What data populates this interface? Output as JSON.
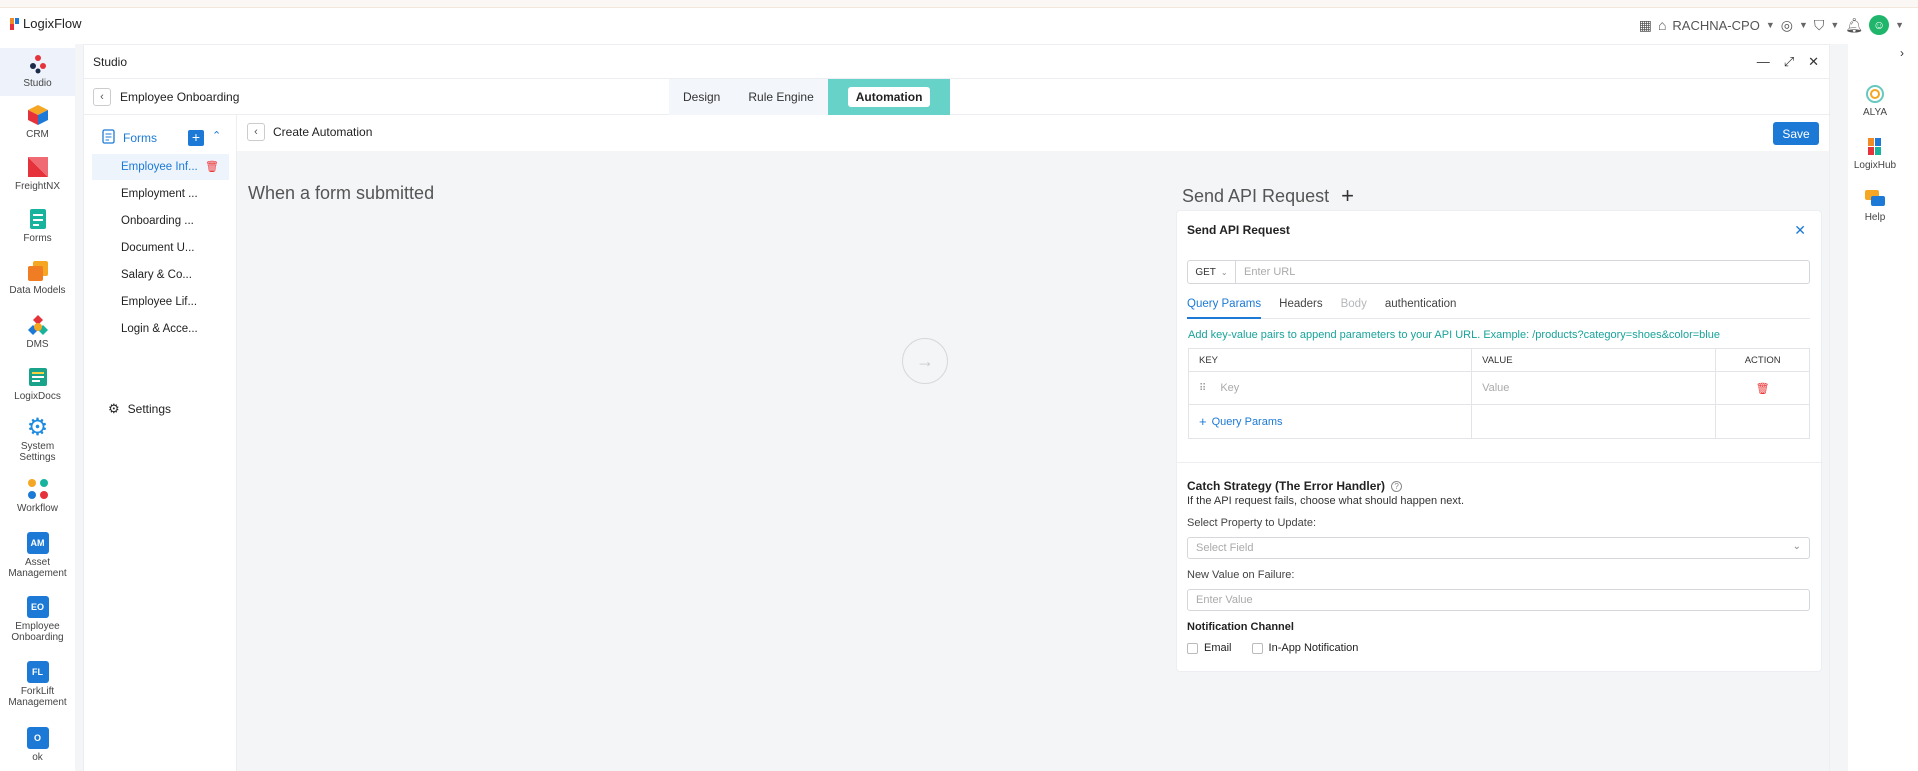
{
  "app": {
    "name": "LogixFlow",
    "user": "RACHNA-CPO"
  },
  "rail": {
    "items": [
      {
        "label": "Studio"
      },
      {
        "label": "CRM"
      },
      {
        "label": "FreightNX"
      },
      {
        "label": "Forms"
      },
      {
        "label": "Data Models"
      },
      {
        "label": "DMS"
      },
      {
        "label": "LogixDocs"
      },
      {
        "label_line1": "System",
        "label_line2": "Settings"
      },
      {
        "label": "Workflow"
      },
      {
        "badge": "AM",
        "label_line1": "Asset",
        "label_line2": "Management"
      },
      {
        "badge": "EO",
        "label_line1": "Employee",
        "label_line2": "Onboarding"
      },
      {
        "badge": "FL",
        "label_line1": "ForkLift",
        "label_line2": "Management"
      },
      {
        "badge": "O",
        "label": "ok"
      }
    ]
  },
  "right_rail": {
    "items": [
      {
        "label": "ALYA"
      },
      {
        "label": "LogixHub"
      },
      {
        "label": "Help"
      }
    ]
  },
  "studio": {
    "title": "Studio",
    "breadcrumb": "Employee Onboarding",
    "tabs": [
      {
        "label": "Design"
      },
      {
        "label": "Rule Engine"
      },
      {
        "label": "Automation"
      }
    ]
  },
  "forms": {
    "header": "Forms",
    "items": [
      {
        "label": "Employee Inf..."
      },
      {
        "label": "Employment ..."
      },
      {
        "label": "Onboarding ..."
      },
      {
        "label": "Document U..."
      },
      {
        "label": "Salary & Co..."
      },
      {
        "label": "Employee Lif..."
      },
      {
        "label": "Login & Acce..."
      }
    ],
    "settings_label": "Settings"
  },
  "automation": {
    "header": "Create Automation",
    "save_label": "Save",
    "trigger_title": "When a form submitted",
    "action_title": "Send API Request"
  },
  "api_card": {
    "title": "Send API Request",
    "method": "GET",
    "url_placeholder": "Enter URL",
    "tabs": [
      {
        "label": "Query Params"
      },
      {
        "label": "Headers"
      },
      {
        "label": "Body"
      },
      {
        "label": "authentication"
      }
    ],
    "hint": "Add key-value pairs to append parameters to your API URL. Example: /products?category=shoes&color=blue",
    "table": {
      "columns": [
        "KEY",
        "VALUE",
        "ACTION"
      ],
      "key_placeholder": "Key",
      "value_placeholder": "Value",
      "add_label": "Query Params"
    },
    "catch": {
      "title": "Catch Strategy (The Error Handler)",
      "description": "If the API request fails, choose what should happen next.",
      "property_label": "Select Property to Update:",
      "property_placeholder": "Select Field",
      "value_label": "New Value on Failure:",
      "value_placeholder": "Enter Value"
    },
    "notification": {
      "title": "Notification Channel",
      "options": [
        {
          "label": "Email"
        },
        {
          "label": "In-App Notification"
        }
      ]
    }
  },
  "colors": {
    "primary": "#1c7ad6",
    "accent_tab": "#67d3c8",
    "hint": "#17a39a",
    "danger": "#e33333"
  }
}
